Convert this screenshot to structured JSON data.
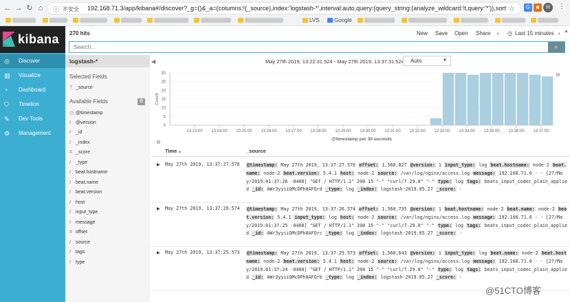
{
  "browser": {
    "insecure_label": "不安全",
    "url": "192.168.71.3/app/kibana#/discover?_g=()&_a=(columns:!(_source),index:'logstash-*',interval:auto,query:(query_string:(analyze_wildcard:!t,query:'*')),sort:!('@ti...",
    "profile_initial": "H",
    "bookmarks": [
      "LVS",
      "Google"
    ]
  },
  "app": {
    "logo_text": "kibana",
    "nav": [
      {
        "label": "Discover",
        "icon": "compass-icon"
      },
      {
        "label": "Visualize",
        "icon": "bar-chart-icon"
      },
      {
        "label": "Dashboard",
        "icon": "dashboard-icon"
      },
      {
        "label": "Timelion",
        "icon": "shield-icon"
      },
      {
        "label": "Dev Tools",
        "icon": "wrench-icon"
      },
      {
        "label": "Management",
        "icon": "gear-icon"
      }
    ]
  },
  "toolbar": {
    "hits": "270 hits",
    "new": "New",
    "save": "Save",
    "open": "Open",
    "share": "Share",
    "timepicker": "Last 15 minutes"
  },
  "search": {
    "placeholder": "Search..."
  },
  "fields": {
    "index_pattern": "logstash-*",
    "selected_title": "Selected Fields",
    "selected": [
      {
        "type": "?",
        "name": "_source"
      }
    ],
    "available_title": "Available Fields",
    "available": [
      {
        "type": "◷",
        "name": "@timestamp"
      },
      {
        "type": "t",
        "name": "@version"
      },
      {
        "type": "t",
        "name": "_id"
      },
      {
        "type": "t",
        "name": "_index"
      },
      {
        "type": "#",
        "name": "_score"
      },
      {
        "type": "t",
        "name": "_type"
      },
      {
        "type": "t",
        "name": "beat.hostname"
      },
      {
        "type": "t",
        "name": "beat.name"
      },
      {
        "type": "t",
        "name": "beat.version"
      },
      {
        "type": "t",
        "name": "host"
      },
      {
        "type": "t",
        "name": "input_type"
      },
      {
        "type": "t",
        "name": "message"
      },
      {
        "type": "#",
        "name": "offset"
      },
      {
        "type": "t",
        "name": "source"
      },
      {
        "type": "t",
        "name": "tags"
      },
      {
        "type": "t",
        "name": "type"
      }
    ]
  },
  "histogram": {
    "range_text": "May 27th 2019, 13:22:31.524 - May 27th 2019, 13:37:31.524 —",
    "interval": "Auto"
  },
  "chart_data": {
    "type": "bar",
    "xlabel": "@timestamp per 30 seconds",
    "ylabel": "Count",
    "ylim": [
      0,
      30
    ],
    "yticks": [
      0,
      5,
      10,
      15,
      20,
      25,
      30
    ],
    "xticks": [
      "13:23:00",
      "13:24:00",
      "13:25:00",
      "13:26:00",
      "13:27:00",
      "13:28:00",
      "13:29:00",
      "13:30:00",
      "13:31:00",
      "13:32:00",
      "13:33:00",
      "13:34:00",
      "13:35:00",
      "13:36:00",
      "13:37:00"
    ],
    "bar_minutes_from_1322": [
      10.5,
      11.0,
      11.5,
      12.0,
      12.5,
      13.0,
      13.5,
      14.0,
      14.5,
      15.0
    ],
    "values": [
      4,
      30,
      30,
      29,
      30,
      30,
      30,
      30,
      29,
      28
    ],
    "color": "#aacfde"
  },
  "table": {
    "col_time": "Time",
    "col_source": "_source",
    "rows": [
      {
        "time": "May 27th 2019, 13:37:27.576",
        "source": [
          [
            "@timestamp:",
            "May 27th 2019, 13:37:27.576"
          ],
          [
            "offset:",
            "1,560,827"
          ],
          [
            "@version:",
            "1"
          ],
          [
            "input_type:",
            "log"
          ],
          [
            "beat.hostname:",
            "node-2"
          ],
          [
            "beat.name:",
            "node-2"
          ],
          [
            "beat.version:",
            "5.4.1"
          ],
          [
            "host:",
            "node-2"
          ],
          [
            "source:",
            "/var/log/nginx/access.log"
          ],
          [
            "message:",
            "192.168.71.6 - - [27/May/2019:01:37:26 -0400] \"GET / HTTP/1.1\" 200 15 \"-\" \"curl/7.29.0\" \"-\""
          ],
          [
            "type:",
            "log"
          ],
          [
            "tags:",
            "beats_input_codec_plain_applied"
          ],
          [
            "_id:",
            "AWr3yyiiQMcDPh8AFQrd"
          ],
          [
            "_type:",
            "log"
          ],
          [
            "_index:",
            "logstash-2019.05.27"
          ],
          [
            "_score:",
            "-"
          ]
        ]
      },
      {
        "time": "May 27th 2019, 13:37:26.574",
        "source": [
          [
            "@timestamp:",
            "May 27th 2019, 13:37:26.574"
          ],
          [
            "offset:",
            "1,560,735"
          ],
          [
            "@version:",
            "1"
          ],
          [
            "beat.hostname:",
            "node-2"
          ],
          [
            "beat.name:",
            "node-2"
          ],
          [
            "beat.version:",
            "5.4.1"
          ],
          [
            "input_type:",
            "log"
          ],
          [
            "host:",
            "node-2"
          ],
          [
            "source:",
            "/var/log/nginx/access.log"
          ],
          [
            "message:",
            "192.168.71.6 - - [27/May/2019:01:37:25 -0400] \"GET / HTTP/1.1\" 200 15 \"-\" \"curl/7.29.0\" \"-\""
          ],
          [
            "type:",
            "log"
          ],
          [
            "tags:",
            "beats_input_codec_plain_applied"
          ],
          [
            "_id:",
            "AWr3yyiiQMcDPh8AFQrc"
          ],
          [
            "_type:",
            "log"
          ],
          [
            "_index:",
            "logstash-2019.05.27"
          ],
          [
            "_score:",
            "-"
          ]
        ]
      },
      {
        "time": "May 27th 2019, 13:37:25.573",
        "source": [
          [
            "@timestamp:",
            "May 27th 2019, 13:37:25.573"
          ],
          [
            "offset:",
            "1,560,643"
          ],
          [
            "@version:",
            "1"
          ],
          [
            "input_type:",
            "log"
          ],
          [
            "beat.name:",
            "node-2"
          ],
          [
            "beat.hostname:",
            "node-2"
          ],
          [
            "beat.version:",
            "5.4.1"
          ],
          [
            "host:",
            "node-2"
          ],
          [
            "source:",
            "/var/log/nginx/access.log"
          ],
          [
            "message:",
            "192.168.71.6 - - [27/May/2019:01:37:24 -0400] \"GET / HTTP/1.1\" 200 15 \"-\" \"curl/7.29.0\" \"-\""
          ],
          [
            "type:",
            "log"
          ],
          [
            "tags:",
            "beats_input_codec_plain_applied"
          ],
          [
            "_id:",
            "AWr3yyiiQMcDPh8AFQrb"
          ],
          [
            "_type:",
            "log"
          ],
          [
            "_index:",
            "logstash-2019.05.27"
          ],
          [
            "_score:",
            "-"
          ]
        ]
      }
    ]
  },
  "watermark": "@51CTO博客"
}
